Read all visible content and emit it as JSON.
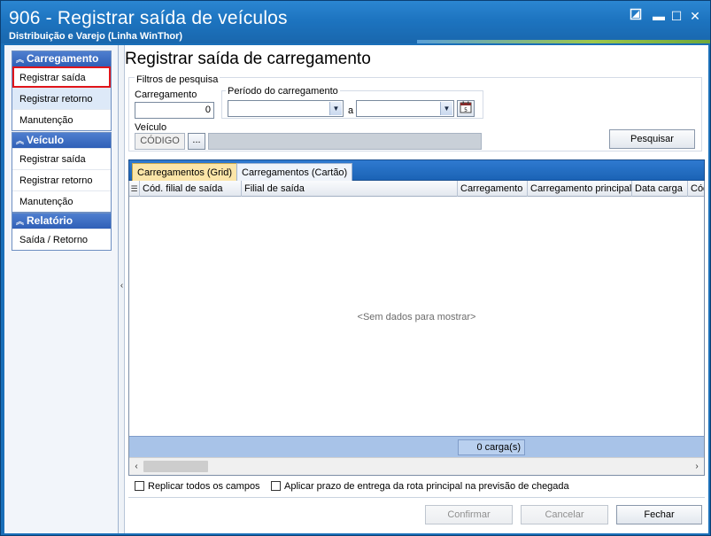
{
  "window": {
    "title": "906 - Registrar saída de veículos",
    "subtitle": "Distribuição e Varejo (Linha WinThor)",
    "buttons": {
      "restore_icon": "restore-icon",
      "minimize": "▬",
      "maximize": "☐",
      "close": "✕"
    }
  },
  "sidebar": {
    "groups": [
      {
        "header": "Carregamento",
        "items": [
          "Registrar saída",
          "Registrar retorno",
          "Manutenção"
        ]
      },
      {
        "header": "Veículo",
        "items": [
          "Registrar saída",
          "Registrar retorno",
          "Manutenção"
        ]
      },
      {
        "header": "Relatório",
        "items": [
          "Saída / Retorno"
        ]
      }
    ]
  },
  "main": {
    "page_title": "Registrar saída de carregamento",
    "filters": {
      "legend": "Filtros de pesquisa",
      "carregamento_label": "Carregamento",
      "carregamento_value": "0",
      "periodo_label": "Período do carregamento",
      "periodo_from": "",
      "periodo_sep": "a",
      "periodo_to": "",
      "veiculo_label": "Veículo",
      "veiculo_code_placeholder": "CÓDIGO",
      "veiculo_ellipsis": "...",
      "search_button": "Pesquisar"
    },
    "tabs": [
      {
        "label": "Carregamentos (Grid)",
        "active": true
      },
      {
        "label": "Carregamentos (Cartão)",
        "active": false
      }
    ],
    "grid": {
      "columns": [
        "Cód. filial de saída",
        "Filial de saída",
        "Carregamento",
        "Carregamento principal",
        "Data carga",
        "Cód"
      ],
      "empty_message": "<Sem dados para mostrar>",
      "footer_count": "0 carga(s)"
    },
    "checkboxes": [
      {
        "label": "Replicar todos os campos",
        "checked": false
      },
      {
        "label": "Aplicar prazo de entrega da rota principal na previsão de chegada",
        "checked": false
      }
    ],
    "actions": {
      "confirm": "Confirmar",
      "cancel": "Cancelar",
      "close": "Fechar"
    }
  }
}
